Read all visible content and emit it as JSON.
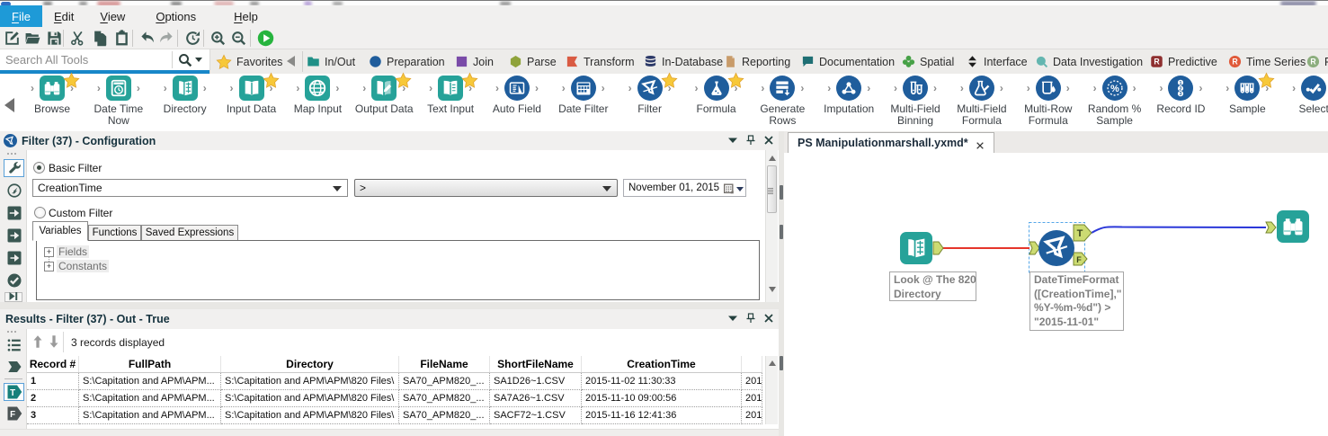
{
  "menu": {
    "items": [
      {
        "label": "File",
        "active": true
      },
      {
        "label": "Edit",
        "active": false
      },
      {
        "label": "View",
        "active": false
      },
      {
        "label": "Options",
        "active": false
      },
      {
        "label": "Help",
        "active": false
      }
    ]
  },
  "toolbar": {
    "buttons": [
      {
        "icon": "new-icon",
        "name": "new"
      },
      {
        "icon": "open-icon",
        "name": "open"
      },
      {
        "icon": "save-icon",
        "name": "save"
      },
      {
        "icon": "cut-icon",
        "name": "cut"
      },
      {
        "icon": "copy-icon",
        "name": "copy"
      },
      {
        "icon": "paste-icon",
        "name": "paste"
      },
      {
        "icon": "undo-icon",
        "name": "undo"
      },
      {
        "icon": "redo-icon",
        "name": "redo",
        "disabled": true
      },
      {
        "icon": "refresh-icon",
        "name": "refresh"
      },
      {
        "icon": "zoom-in-icon",
        "name": "zoom-in"
      },
      {
        "icon": "zoom-out-icon",
        "name": "zoom-out"
      },
      {
        "icon": "run-icon",
        "name": "run"
      }
    ]
  },
  "search": {
    "placeholder": "Search All Tools"
  },
  "categories": {
    "favorites": "Favorites",
    "items": [
      {
        "label": "In/Out",
        "icon": "folder",
        "color": "#1f8f86"
      },
      {
        "label": "Preparation",
        "icon": "circle",
        "color": "#1f5d9c"
      },
      {
        "label": "Join",
        "icon": "square",
        "color": "#7a4ba8"
      },
      {
        "label": "Parse",
        "icon": "hexagon",
        "color": "#8fa33b"
      },
      {
        "label": "Transform",
        "icon": "flag",
        "color": "#d95b43"
      },
      {
        "label": "In-Database",
        "icon": "database",
        "color": "#2c3968"
      },
      {
        "label": "Reporting",
        "icon": "page",
        "color": "#c89b6a"
      },
      {
        "label": "Documentation",
        "icon": "bubble",
        "color": "#1f6f74"
      },
      {
        "label": "Spatial",
        "icon": "clover",
        "color": "#47a147"
      },
      {
        "label": "Interface",
        "icon": "updown",
        "color": "#1c1c1c"
      },
      {
        "label": "Data Investigation",
        "icon": "lens",
        "color": "#64b6b0"
      },
      {
        "label": "Predictive",
        "icon": "rsquare",
        "color": "#8e2f2f"
      },
      {
        "label": "Time Series",
        "icon": "rcircle",
        "color": "#e05a3a"
      },
      {
        "label": "P",
        "icon": "rcircle",
        "color": "#8cae7e"
      }
    ]
  },
  "palette": {
    "tools": [
      {
        "label": "Browse",
        "icon": "browse",
        "family": "teal",
        "starred": true
      },
      {
        "label": "Date Time Now",
        "icon": "datetimenow",
        "family": "teal",
        "starred": false
      },
      {
        "label": "Directory",
        "icon": "directory",
        "family": "teal",
        "starred": false
      },
      {
        "label": "Input Data",
        "icon": "inputdata",
        "family": "teal",
        "starred": true
      },
      {
        "label": "Map Input",
        "icon": "mapinput",
        "family": "teal",
        "starred": false
      },
      {
        "label": "Output Data",
        "icon": "outputdata",
        "family": "teal",
        "starred": true
      },
      {
        "label": "Text Input",
        "icon": "textinput",
        "family": "teal",
        "starred": true
      },
      {
        "label": "Auto Field",
        "icon": "autofield",
        "family": "blue",
        "starred": false
      },
      {
        "label": "Date Filter",
        "icon": "datefilter",
        "family": "blue",
        "starred": false
      },
      {
        "label": "Filter",
        "icon": "filter",
        "family": "blue",
        "starred": true
      },
      {
        "label": "Formula",
        "icon": "formula",
        "family": "blue",
        "starred": true
      },
      {
        "label": "Generate Rows",
        "icon": "generaterows",
        "family": "blue",
        "starred": false
      },
      {
        "label": "Imputation",
        "icon": "imputation",
        "family": "blue",
        "starred": false
      },
      {
        "label": "Multi-Field Binning",
        "icon": "multifieldbinning",
        "family": "blue",
        "starred": false
      },
      {
        "label": "Multi-Field Formula",
        "icon": "multifieldformula",
        "family": "blue",
        "starred": false
      },
      {
        "label": "Multi-Row Formula",
        "icon": "multirowformula",
        "family": "blue",
        "starred": false
      },
      {
        "label": "Random % Sample",
        "icon": "randomsample",
        "family": "blue",
        "starred": false
      },
      {
        "label": "Record ID",
        "icon": "recordid",
        "family": "blue",
        "starred": false
      },
      {
        "label": "Sample",
        "icon": "sample",
        "family": "blue",
        "starred": true
      },
      {
        "label": "Select",
        "icon": "select",
        "family": "blue",
        "starred": false
      }
    ]
  },
  "config_panel": {
    "title": "Filter (37) - Configuration",
    "basic_filter_label": "Basic Filter",
    "custom_filter_label": "Custom Filter",
    "field_value": "CreationTime",
    "operator_value": ">",
    "date_value": "November 01, 2015",
    "tabs": [
      "Variables",
      "Functions",
      "Saved Expressions"
    ],
    "active_tab": "Variables",
    "tree_items": [
      "Fields",
      "Constants"
    ]
  },
  "results_panel": {
    "title": "Results - Filter (37) - Out - True",
    "status": "3 records displayed",
    "table": {
      "columns": [
        "Record #",
        "FullPath",
        "Directory",
        "FileName",
        "ShortFileName",
        "CreationTime",
        ""
      ],
      "rows": [
        [
          "1",
          "S:\\Capitation and APM\\APM...",
          "S:\\Capitation and APM\\APM\\820 Files\\",
          "SA70_APM820_...",
          "SA1D26~1.CSV",
          "2015-11-02 11:30:33",
          "201"
        ],
        [
          "2",
          "S:\\Capitation and APM\\APM...",
          "S:\\Capitation and APM\\APM\\820 Files\\",
          "SA70_APM820_...",
          "SA7A26~1.CSV",
          "2015-11-10 09:00:56",
          "201"
        ],
        [
          "3",
          "S:\\Capitation and APM\\APM...",
          "S:\\Capitation and APM\\APM\\820 Files\\",
          "SA70_APM820_...",
          "SACF72~1.CSV",
          "2015-11-16 12:41:36",
          "201"
        ]
      ]
    }
  },
  "canvas": {
    "tab_title": "PS Manipulationmarshall.yxmd*",
    "directory_annotation": [
      "Look @ The 820",
      "Directory"
    ],
    "filter_annotation": [
      "DateTimeFormat",
      "([CreationTime],\"",
      "%Y-%m-%d\") >",
      "\"2015-11-01\""
    ],
    "true_anchor": "T",
    "false_anchor": "F",
    "wire_colors": {
      "selected": "#e5352b",
      "normal": "#2b38d9"
    }
  }
}
